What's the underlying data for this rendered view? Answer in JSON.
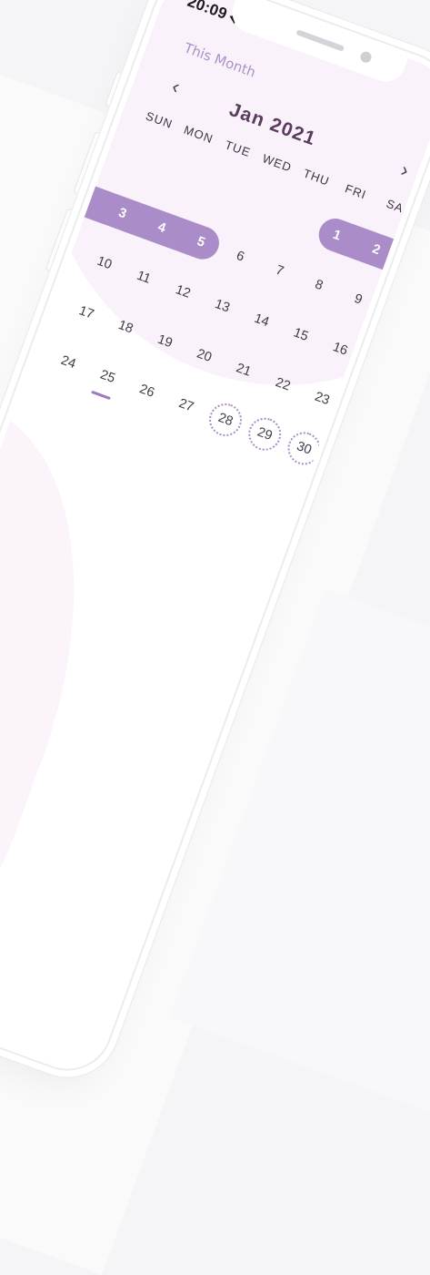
{
  "status_bar": {
    "time": "20:09"
  },
  "header": {
    "this_month_label": "This Month",
    "month_title": "Jan 2021",
    "prev_label": "‹",
    "next_label": "›"
  },
  "weekdays": [
    "SUN",
    "MON",
    "TUE",
    "WED",
    "THU",
    "FRI",
    "SA"
  ],
  "weeks": [
    [
      "",
      "",
      "",
      "",
      "",
      "1",
      "2"
    ],
    [
      "3",
      "4",
      "5",
      "6",
      "7",
      "8",
      "9"
    ],
    [
      "10",
      "11",
      "12",
      "13",
      "14",
      "15",
      "16"
    ],
    [
      "17",
      "18",
      "19",
      "20",
      "21",
      "22",
      "23"
    ],
    [
      "24",
      "25",
      "26",
      "27",
      "28",
      "29",
      "30"
    ]
  ],
  "highlighted_days": [
    "1",
    "2",
    "3",
    "4",
    "5"
  ],
  "upcoming_days": [
    "28",
    "29",
    "30"
  ],
  "today": "25",
  "colors": {
    "accent": "#a98cc8",
    "text": "#3f3a45",
    "title": "#5a3a5e",
    "soft_bg": "#faf2fa"
  }
}
